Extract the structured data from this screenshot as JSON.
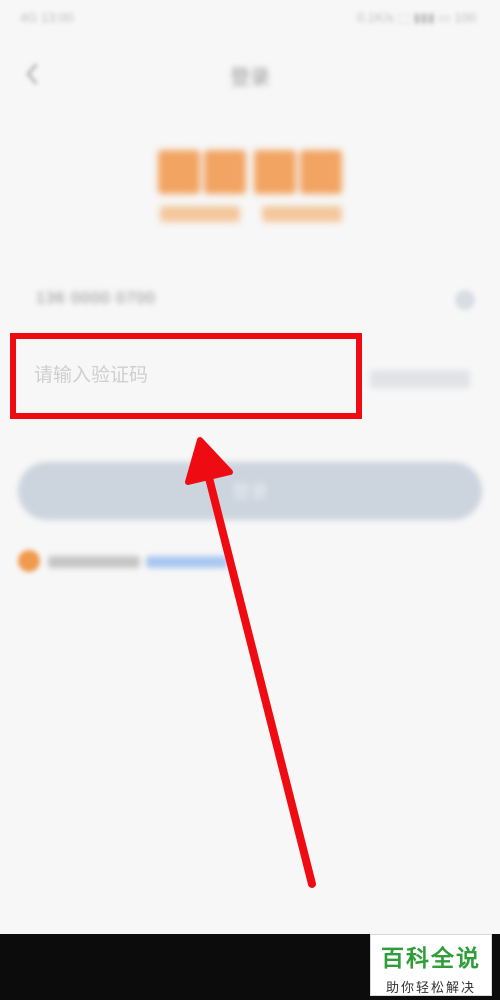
{
  "status_bar": {
    "time": "4G 13:00",
    "icons": "0.1K/s ⬚ ▮▮▮ ▭ 100"
  },
  "nav": {
    "title": "登录"
  },
  "phone": {
    "number": "136 0000 0700"
  },
  "code_input": {
    "placeholder": "请输入验证码",
    "value": ""
  },
  "login_button": {
    "label": "登录"
  },
  "colors": {
    "highlight": "#ee0c12",
    "accent": "#f09a4f",
    "watermark_green": "#2f9e3a"
  },
  "icons": {
    "back": "chevron-left-icon",
    "dropdown": "chevron-down-icon"
  },
  "watermark": {
    "title": "百科全说",
    "subtitle": "助你轻松解决"
  }
}
